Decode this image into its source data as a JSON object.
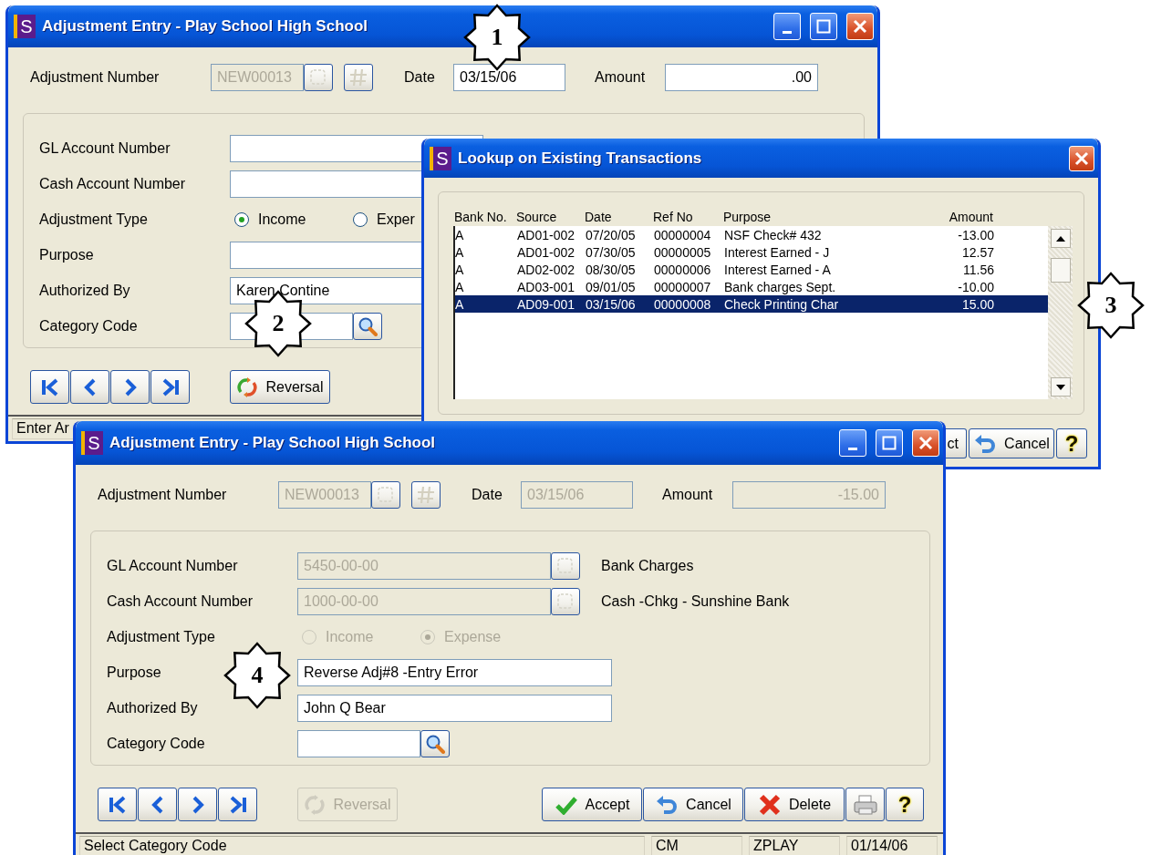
{
  "back_window": {
    "icon_letter": "S",
    "title": "Adjustment Entry - Play School High School",
    "title_controls": [
      {
        "kind": "minimize"
      },
      {
        "kind": "maximize"
      },
      {
        "kind": "close"
      }
    ],
    "header": {
      "number": {
        "label": "Adjustment Number",
        "value": "NEW00013",
        "disabled": true
      },
      "date": {
        "label": "Date",
        "value": "03/15/06",
        "disabled": false
      },
      "amount": {
        "label": "Amount",
        "value": ".00",
        "disabled": false
      }
    },
    "rows": [
      {
        "kind": "field",
        "label": "GL Account Number",
        "disabled": false
      },
      {
        "kind": "field",
        "label": "Cash Account Number",
        "disabled": false
      },
      {
        "kind": "radio",
        "label": "Adjustment Type",
        "options": [
          {
            "label": "Income",
            "selected": true,
            "disabled": false
          },
          {
            "label": "Exper",
            "selected": false,
            "disabled": false
          }
        ]
      },
      {
        "kind": "text",
        "label": "Purpose",
        "disabled": false
      },
      {
        "kind": "text",
        "label": "Authorized By",
        "value": "Karen Contine",
        "disabled": false
      },
      {
        "kind": "category",
        "label": "Category Code"
      }
    ],
    "nav_buttons": [
      {
        "kind": "first"
      },
      {
        "kind": "previous"
      },
      {
        "kind": "next"
      },
      {
        "kind": "last"
      }
    ],
    "reversal": {
      "label": "Reversal",
      "disabled": false
    },
    "status": [
      "Enter Ar"
    ]
  },
  "lookup_dialog": {
    "icon_letter": "S",
    "title": "Lookup on Existing Transactions",
    "title_controls": [
      {
        "kind": "close"
      }
    ],
    "columns": [
      "Bank No.",
      "Source",
      "Date",
      "Ref No",
      "Purpose",
      "Amount"
    ],
    "rows": [
      {
        "cells": [
          "A",
          "AD01-002",
          "07/20/05",
          "00000004",
          "NSF Check# 432",
          "-13.00"
        ],
        "selected": false
      },
      {
        "cells": [
          "A",
          "AD01-002",
          "07/30/05",
          "00000005",
          "Interest Earned - J",
          "12.57"
        ],
        "selected": false
      },
      {
        "cells": [
          "A",
          "AD02-002",
          "08/30/05",
          "00000006",
          "Interest Earned - A",
          "11.56"
        ],
        "selected": false
      },
      {
        "cells": [
          "A",
          "AD03-001",
          "09/01/05",
          "00000007",
          "Bank charges Sept.",
          "-10.00"
        ],
        "selected": false
      },
      {
        "cells": [
          "A",
          "AD09-001",
          "03/15/06",
          "00000008",
          "Check Printing Char",
          "15.00"
        ],
        "selected": true
      }
    ],
    "buttons": [
      {
        "kind": "select",
        "label": "ct"
      },
      {
        "kind": "cancel",
        "label": "Cancel"
      },
      {
        "kind": "help",
        "label": "?"
      }
    ]
  },
  "front_window": {
    "icon_letter": "S",
    "title": "Adjustment Entry - Play School High School",
    "title_controls": [
      {
        "kind": "minimize"
      },
      {
        "kind": "maximize"
      },
      {
        "kind": "close"
      }
    ],
    "header": {
      "number": {
        "label": "Adjustment Number",
        "value": "NEW00013",
        "disabled": true
      },
      "date": {
        "label": "Date",
        "value": "03/15/06",
        "disabled": true
      },
      "amount": {
        "label": "Amount",
        "value": "-15.00",
        "disabled": true
      }
    },
    "rows": [
      {
        "kind": "account",
        "label": "GL Account Number",
        "value": "5450-00-00",
        "disabled": true,
        "description": "Bank Charges"
      },
      {
        "kind": "account",
        "label": "Cash Account Number",
        "value": "1000-00-00",
        "disabled": true,
        "description": "Cash -Chkg - Sunshine Bank"
      },
      {
        "kind": "radio",
        "label": "Adjustment Type",
        "options": [
          {
            "label": "Income",
            "selected": false,
            "disabled": true
          },
          {
            "label": "Expense",
            "selected": true,
            "disabled": true
          }
        ]
      },
      {
        "kind": "text",
        "label": "Purpose",
        "value": "Reverse Adj#8 -Entry Error",
        "disabled": false
      },
      {
        "kind": "text",
        "label": "Authorized By",
        "value": "John Q Bear",
        "disabled": false
      },
      {
        "kind": "category",
        "label": "Category Code"
      }
    ],
    "nav_buttons": [
      {
        "kind": "first"
      },
      {
        "kind": "previous"
      },
      {
        "kind": "next"
      },
      {
        "kind": "last"
      }
    ],
    "reversal": {
      "label": "Reversal",
      "disabled": true
    },
    "actions": [
      {
        "kind": "accept",
        "label": "Accept"
      },
      {
        "kind": "cancel",
        "label": "Cancel"
      },
      {
        "kind": "delete",
        "label": "Delete"
      },
      {
        "kind": "print"
      },
      {
        "kind": "help",
        "label": "?"
      }
    ],
    "status": [
      "Select Category Code",
      "CM",
      "ZPLAY",
      "01/14/06"
    ]
  },
  "callouts": [
    {
      "number": "1"
    },
    {
      "number": "2"
    },
    {
      "number": "3"
    },
    {
      "number": "4"
    }
  ]
}
